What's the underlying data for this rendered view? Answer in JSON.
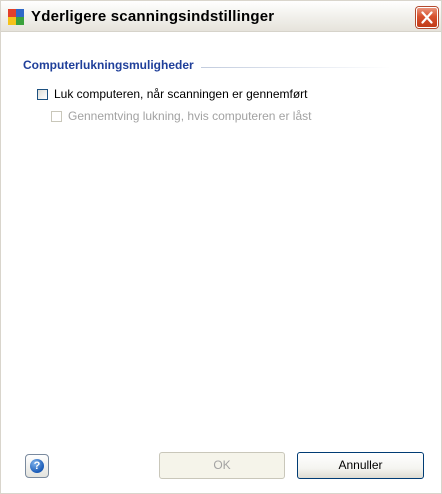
{
  "window": {
    "title": "Yderligere scanningsindstillinger"
  },
  "group": {
    "title": "Computerlukningsmuligheder"
  },
  "options": [
    {
      "label": "Luk computeren, når scanningen er gennemført",
      "checked": false,
      "enabled": true
    },
    {
      "label": "Gennemtving lukning, hvis computeren er låst",
      "checked": false,
      "enabled": false
    }
  ],
  "buttons": {
    "ok": "OK",
    "cancel": "Annuller",
    "help_icon": "help-icon"
  },
  "colors": {
    "group_title": "#1f3f9a",
    "close_button": "#d7512e",
    "disabled_text": "#a2a2a2"
  }
}
